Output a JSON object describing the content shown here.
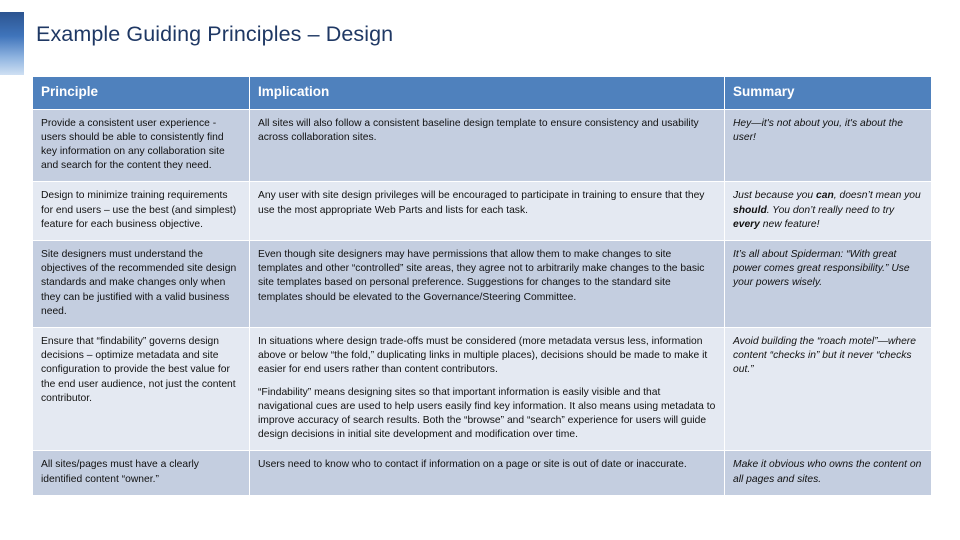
{
  "slide": {
    "title": "Example Guiding Principles – Design",
    "accent_color": "#4f81bd",
    "title_color": "#1f3864",
    "band_dark_color": "#c4cee0",
    "band_light_color": "#e4e9f2"
  },
  "table": {
    "headers": {
      "principle": "Principle",
      "implication": "Implication",
      "summary": "Summary"
    },
    "rows": [
      {
        "principle": "Provide a consistent user experience - users should be able to consistently find key information on any collaboration site and search for the content they need.",
        "implication_p1": "All sites will also follow a consistent baseline design template to ensure consistency and usability across collaboration sites.",
        "implication_p2": "",
        "summary_a": "Hey—it's not about you, it's about the user!",
        "summary_em1": "",
        "summary_b": "",
        "summary_em2": "",
        "summary_c": "",
        "summary_em3": "",
        "summary_d": ""
      },
      {
        "principle": "Design to minimize training requirements for end users – use the best (and simplest) feature for each business objective.",
        "implication_p1": "Any user with site design privileges will be encouraged to participate in training to ensure that they use the most appropriate Web Parts and lists for each task.",
        "implication_p2": "",
        "summary_a": "Just because you ",
        "summary_em1": "can",
        "summary_b": ", doesn’t mean you ",
        "summary_em2": "should",
        "summary_c": ". You don’t really need to try ",
        "summary_em3": "every",
        "summary_d": " new feature!"
      },
      {
        "principle": "Site designers must understand the objectives of the recommended site design standards and make changes only when they can be justified with a valid business need.",
        "implication_p1": "Even though site designers may have permissions that allow them to make changes to site templates and other “controlled” site areas, they agree not to arbitrarily make changes to the basic site templates based on personal preference. Suggestions for changes to the standard site templates should be elevated to the Governance/Steering Committee.",
        "implication_p2": "",
        "summary_a": "It’s all about Spiderman: “With great power comes great responsibility.” Use your powers wisely.",
        "summary_em1": "",
        "summary_b": "",
        "summary_em2": "",
        "summary_c": "",
        "summary_em3": "",
        "summary_d": ""
      },
      {
        "principle": "Ensure that “findability” governs design decisions – optimize metadata and site configuration to provide the best value for the end user audience, not just the content contributor.",
        "implication_p1": "In situations where design trade-offs must be considered (more metadata versus less, information above or below “the fold,” duplicating links in multiple places), decisions should be made to make it easier for end users rather than content contributors.",
        "implication_p2": "“Findability” means designing sites so that important information is easily visible and that navigational cues are used to help users easily find key information. It also means using metadata to improve accuracy of search results. Both the “browse” and “search” experience for users will guide design decisions in initial site development and modification over time.",
        "summary_a": "Avoid building the “roach motel”—where content “checks in” but it never “checks out.”",
        "summary_em1": "",
        "summary_b": "",
        "summary_em2": "",
        "summary_c": "",
        "summary_em3": "",
        "summary_d": ""
      },
      {
        "principle": "All sites/pages must have a clearly identified content “owner.”",
        "implication_p1": "Users need to know who to contact if information on a page or site is out of date or inaccurate.",
        "implication_p2": "",
        "summary_a": "Make it obvious who owns the content on all pages and sites.",
        "summary_em1": "",
        "summary_b": "",
        "summary_em2": "",
        "summary_c": "",
        "summary_em3": "",
        "summary_d": ""
      }
    ]
  }
}
